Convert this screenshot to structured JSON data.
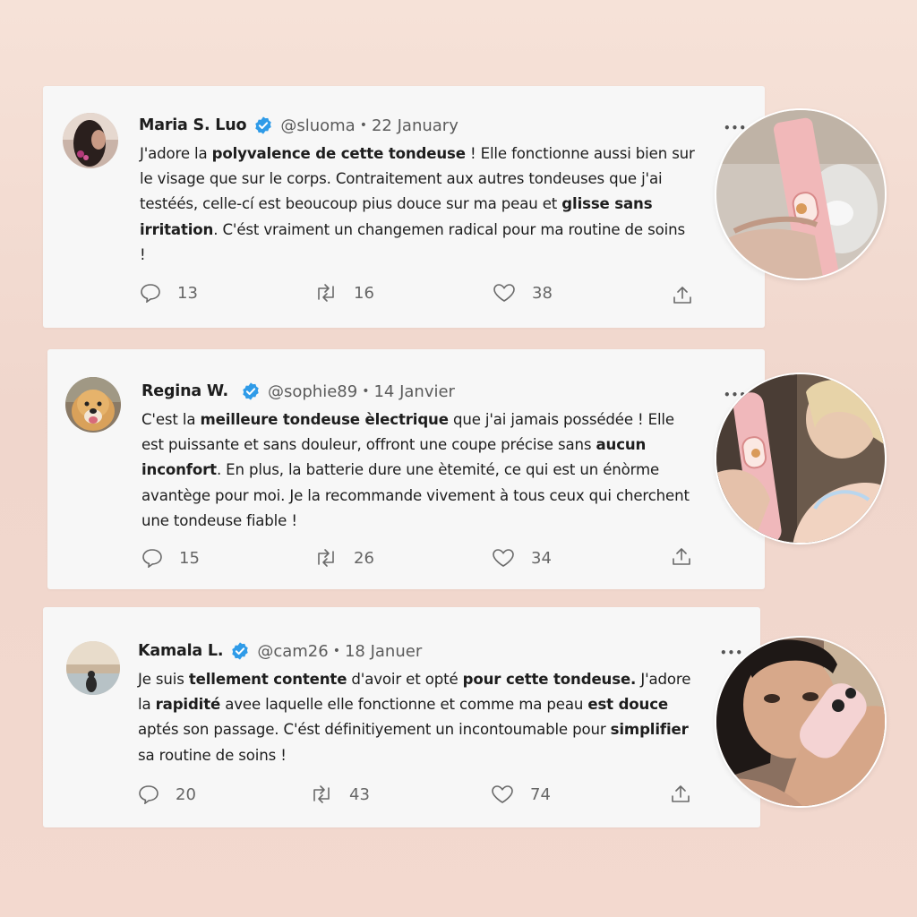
{
  "tweets": [
    {
      "name": "Maria S. Luo",
      "handle": "@sluoma",
      "dot": "•",
      "date": "22 January",
      "more": "•••",
      "body": [
        {
          "t": "J'adore la ",
          "b": false
        },
        {
          "t": "polyvalence de cette tondeuse",
          "b": true
        },
        {
          "t": " ! ",
          "b": false
        },
        {
          "t": "Elle fonctionne aussi bien sur le visage que sur le corps. Contraitement aux autres tondeuses que j'ai testéés, celle-cí est beoucoup pius douce sur ma peau et ",
          "b": false
        },
        {
          "t": "glisse sans irritation",
          "b": true
        },
        {
          "t": ". C'ést vraiment un changemen radical pour ma routine de soins !",
          "b": false
        }
      ],
      "reply_count": "13",
      "retweet_count": "16",
      "like_count": "38"
    },
    {
      "name": "Regina W.",
      "handle": "@sophie89",
      "dot": "•",
      "date": "14 Janvier",
      "more": "•••",
      "body": [
        {
          "t": "C'est la ",
          "b": false
        },
        {
          "t": "meilleure tondeuse èlectrique",
          "b": true
        },
        {
          "t": " que j'ai jamais possédée ! Elle est puissante et sans douleur, offront une coupe précise sans ",
          "b": false
        },
        {
          "t": "aucun inconfort",
          "b": true
        },
        {
          "t": ". En plus, la batterie dure une ètemité, ce qui est un énòrme avantège pour moi. Je la recommande vivement à tous ceux qui cherchent une tondeuse fiable !",
          "b": false
        }
      ],
      "reply_count": "15",
      "retweet_count": "26",
      "like_count": "34"
    },
    {
      "name": "Kamala L.",
      "handle": "@cam26",
      "dot": "•",
      "date": "18 Januer",
      "more": "•••",
      "body": [
        {
          "t": "Je suis ",
          "b": false
        },
        {
          "t": "tellement contente",
          "b": true
        },
        {
          "t": " d'avoir et opté ",
          "b": false
        },
        {
          "t": "pour cette tondeuse.",
          "b": true
        },
        {
          "t": " J'adore la ",
          "b": false
        },
        {
          "t": "rapidité",
          "b": true
        },
        {
          "t": " avee laquelle elle fonctionne et comme ma peau ",
          "b": false
        },
        {
          "t": "est douce",
          "b": true
        },
        {
          "t": " aptés son passage. C'ést définitiyement un incontoumable pour ",
          "b": false
        },
        {
          "t": "simplifier",
          "b": true
        },
        {
          "t": " sa routine de soins !",
          "b": false
        }
      ],
      "reply_count": "20",
      "retweet_count": "43",
      "like_count": "74"
    }
  ],
  "colors": {
    "verified": "#2f9be8",
    "icon": "#6a6a6a",
    "card": "#f7f7f7"
  }
}
